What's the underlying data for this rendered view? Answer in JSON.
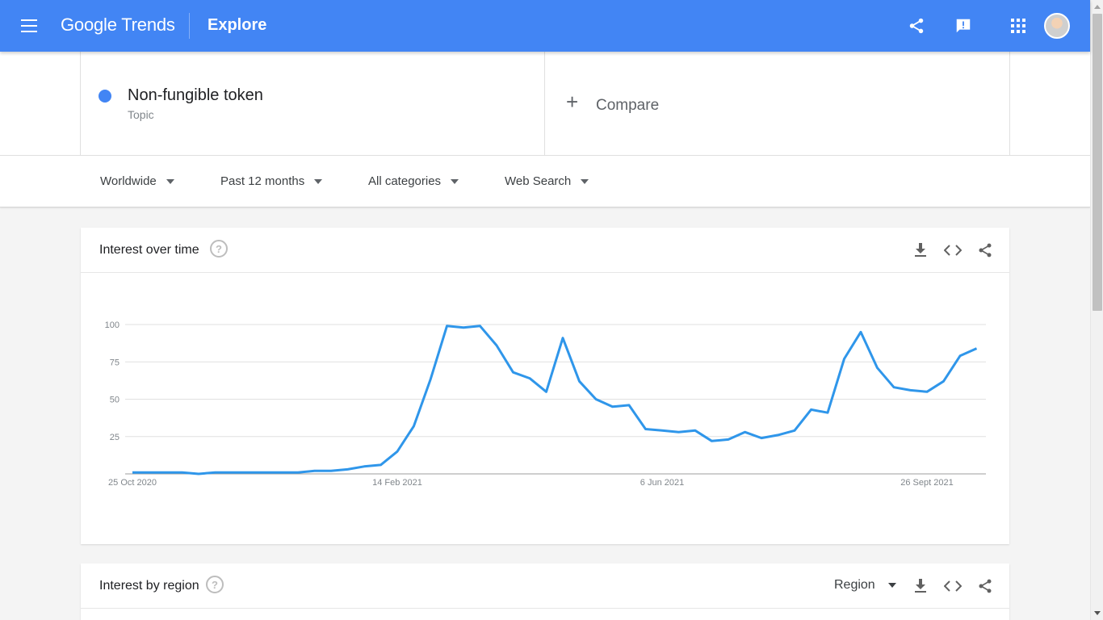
{
  "header": {
    "logo": "Google Trends",
    "section": "Explore",
    "icons": [
      "menu-icon",
      "share-icon",
      "feedback-icon",
      "apps-icon",
      "avatar"
    ]
  },
  "search": {
    "term_name": "Non-fungible token",
    "term_type": "Topic",
    "term_color": "#4285f4",
    "compare_label": "Compare"
  },
  "filters": {
    "location": "Worldwide",
    "time": "Past 12 months",
    "category": "All categories",
    "search_type": "Web Search"
  },
  "interest_over_time": {
    "title": "Interest over time",
    "help": "?"
  },
  "interest_by_region": {
    "title": "Interest by region",
    "help": "?",
    "resolution": "Region"
  },
  "colors": {
    "brand": "#4285f4",
    "series": "#2f96ea"
  },
  "chart_data": {
    "type": "line",
    "ylim": [
      0,
      100
    ],
    "yticks": [
      25,
      50,
      75,
      100
    ],
    "x_tick_labels": [
      "25 Oct 2020",
      "14 Feb 2021",
      "6 Jun 2021",
      "26 Sept 2021"
    ],
    "x_tick_weeks": [
      0,
      16,
      32,
      48
    ],
    "grid": true,
    "series": [
      {
        "values": [
          1,
          1,
          1,
          1,
          0,
          1,
          1,
          1,
          1,
          1,
          1,
          2,
          2,
          3,
          5,
          6,
          15,
          32,
          63,
          99,
          98,
          99,
          86,
          68,
          64,
          55,
          91,
          62,
          50,
          45,
          46,
          30,
          29,
          28,
          29,
          22,
          23,
          28,
          24,
          26,
          29,
          43,
          41,
          77,
          95,
          71,
          58,
          56,
          55,
          62,
          79,
          84
        ]
      }
    ]
  }
}
